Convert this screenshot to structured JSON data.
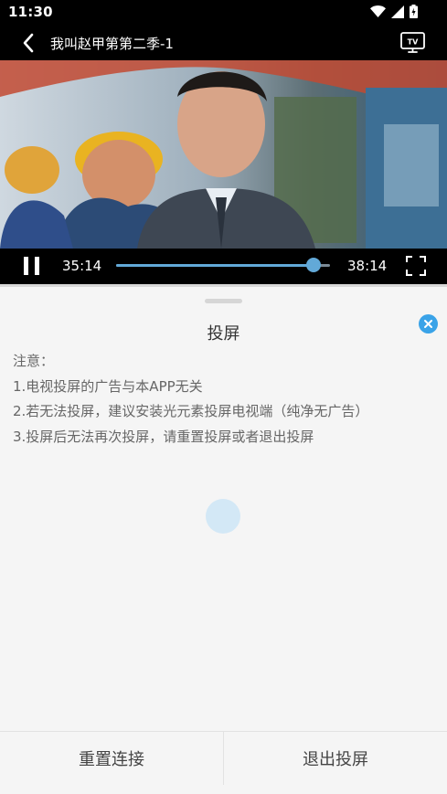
{
  "status_bar": {
    "time": "11:30",
    "icons": [
      "wifi-icon",
      "cell-signal-icon",
      "battery-charging-icon"
    ]
  },
  "header": {
    "title": "我叫赵甲第第二季-1",
    "back_icon": "chevron-left-icon",
    "cast_icon": "tv-icon",
    "cast_icon_text": "TV"
  },
  "player": {
    "current_time": "35:14",
    "total_time": "38:14",
    "progress": 0.922,
    "accent_color": "#62a9d8"
  },
  "cast_sheet": {
    "title": "投屏",
    "notes": [
      "注意：",
      "1.电视投屏的广告与本APP无关",
      "2.若无法投屏，建议安装光元素投屏电视端（纯净无广告）",
      "3.投屏后无法再次投屏，请重置投屏或者退出投屏"
    ],
    "close_color": "#3aa3e8"
  },
  "actions": {
    "reset_label": "重置连接",
    "exit_label": "退出投屏"
  }
}
